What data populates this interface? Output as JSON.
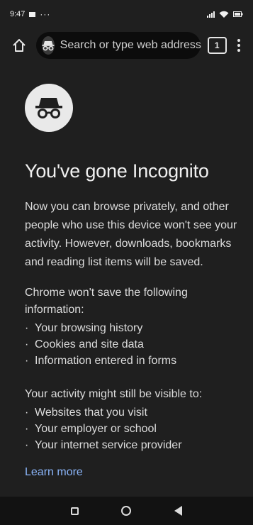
{
  "status_bar": {
    "time": "9:47",
    "overflow": "···"
  },
  "toolbar": {
    "home_icon": "home-icon",
    "search_placeholder": "Search or type web address",
    "tab_count": "1"
  },
  "content": {
    "title": "You've gone Incognito",
    "intro": "Now you can browse privately, and other people who use this device won't see your activity. However, downloads, bookmarks and reading list items will be saved.",
    "not_saved_heading": "Chrome won't save the following information:",
    "not_saved_items": [
      "Your browsing history",
      "Cookies and site data",
      "Information entered in forms"
    ],
    "visible_heading": "Your activity might still be visible to:",
    "visible_items": [
      "Websites that you visit",
      "Your employer or school",
      "Your internet service provider"
    ],
    "learn_more": "Learn more"
  },
  "colors": {
    "background": "#1f1f1f",
    "omnibox": "#0c0c0c",
    "link": "#8ab4f8"
  }
}
